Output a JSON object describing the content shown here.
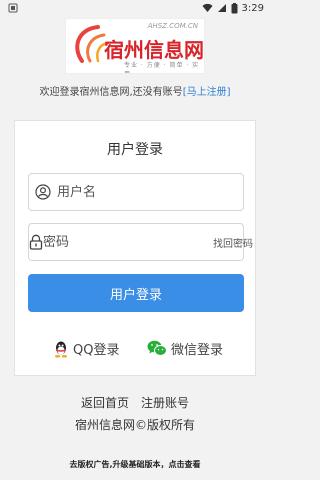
{
  "status": {
    "time": "3:29"
  },
  "logo": {
    "url": "AHSZ.COM.CN",
    "name": "宿州信息网",
    "slogan": "专业 · 方便 · 简单 · 实用"
  },
  "welcome": {
    "text": "欢迎登录宿州信息网,还没有账号",
    "link": "[马上注册]"
  },
  "login": {
    "title": "用户登录",
    "username_placeholder": "用户名",
    "password_placeholder": "密码",
    "forgot": "找回密码",
    "submit": "用户登录",
    "qq": "QQ登录",
    "wechat": "微信登录"
  },
  "footer": {
    "home": "返回首页",
    "register": "注册账号",
    "copyright": "宿州信息网©版权所有",
    "ad": "去版权广告,升级基础版本，点击查看"
  },
  "colors": {
    "accent": "#3a8ee6",
    "logo_red": "#d7262b",
    "link": "#2b7fd6"
  }
}
